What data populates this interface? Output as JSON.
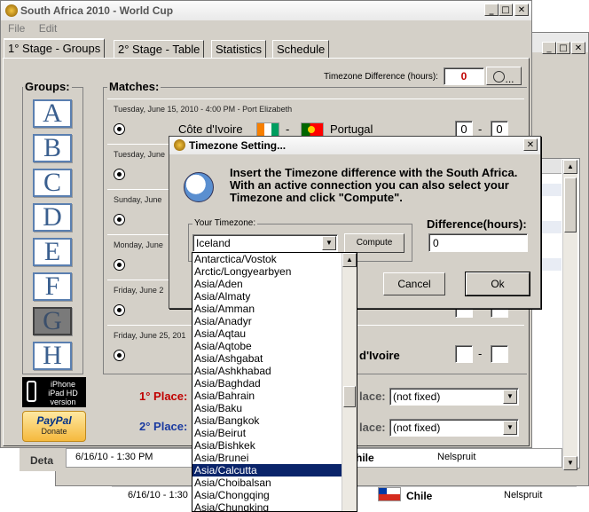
{
  "main_window": {
    "title": "South Africa 2010 - World Cup",
    "menu": [
      "File",
      "Edit"
    ],
    "tabs": [
      "1° Stage - Groups",
      "2° Stage - Table",
      "Statistics",
      "Schedule"
    ],
    "timezone_label": "Timezone Difference (hours):",
    "timezone_value": "0",
    "groups_label": "Groups:",
    "matches_label": "Matches:",
    "groups": [
      "A",
      "B",
      "C",
      "D",
      "E",
      "F",
      "G",
      "H"
    ],
    "selected_group": "G",
    "iphone_badge": [
      "iPhone",
      "iPad HD",
      "version"
    ],
    "paypal_badge": [
      "PayPal",
      "Donate"
    ],
    "first_place_label": "1° Place:",
    "second_place_label": "2° Place:",
    "place_value_1": "(not fixed)",
    "place_value_2": "(not fixed)",
    "place_label_short": "lace:",
    "details_label": "Deta"
  },
  "matches": [
    {
      "date": "Tuesday, June 15, 2010 - 4:00 PM - Port Elizabeth",
      "home": "Côte d'Ivoire",
      "away": "Portugal",
      "score_home": "0",
      "score_away": "0"
    },
    {
      "date": "Tuesday, June"
    },
    {
      "date": "Sunday, June"
    },
    {
      "date": "Monday, June"
    },
    {
      "date": "Friday, June 2"
    },
    {
      "date": "Friday, June 25, 201",
      "away_partial": "d'Ivoire"
    }
  ],
  "bg_table_rows": [
    {
      "date": "6/16/10 - 1:30 PM",
      "team": "hile",
      "venue": "Nelspruit"
    },
    {
      "date": "6/16/10 - 1:30",
      "team": "Chile",
      "venue": "Nelspruit"
    }
  ],
  "dialog": {
    "title": "Timezone Setting...",
    "message": "Insert the Timezone difference with the South Africa.\nWith an active connection you can also select your\nTimezone and click \"Compute\".",
    "your_timezone_label": "Your Timezone:",
    "selected_timezone": "Iceland",
    "compute_label": "Compute",
    "difference_label": "Difference(hours):",
    "difference_value": "0",
    "cancel_label": "Cancel",
    "ok_label": "Ok"
  },
  "timezone_list": {
    "items": [
      "Antarctica/Vostok",
      "Arctic/Longyearbyen",
      "Asia/Aden",
      "Asia/Almaty",
      "Asia/Amman",
      "Asia/Anadyr",
      "Asia/Aqtau",
      "Asia/Aqtobe",
      "Asia/Ashgabat",
      "Asia/Ashkhabad",
      "Asia/Baghdad",
      "Asia/Bahrain",
      "Asia/Baku",
      "Asia/Bangkok",
      "Asia/Beirut",
      "Asia/Bishkek",
      "Asia/Brunei",
      "Asia/Calcutta",
      "Asia/Choibalsan",
      "Asia/Chongqing",
      "Asia/Chungking"
    ],
    "selected": "Asia/Calcutta"
  }
}
